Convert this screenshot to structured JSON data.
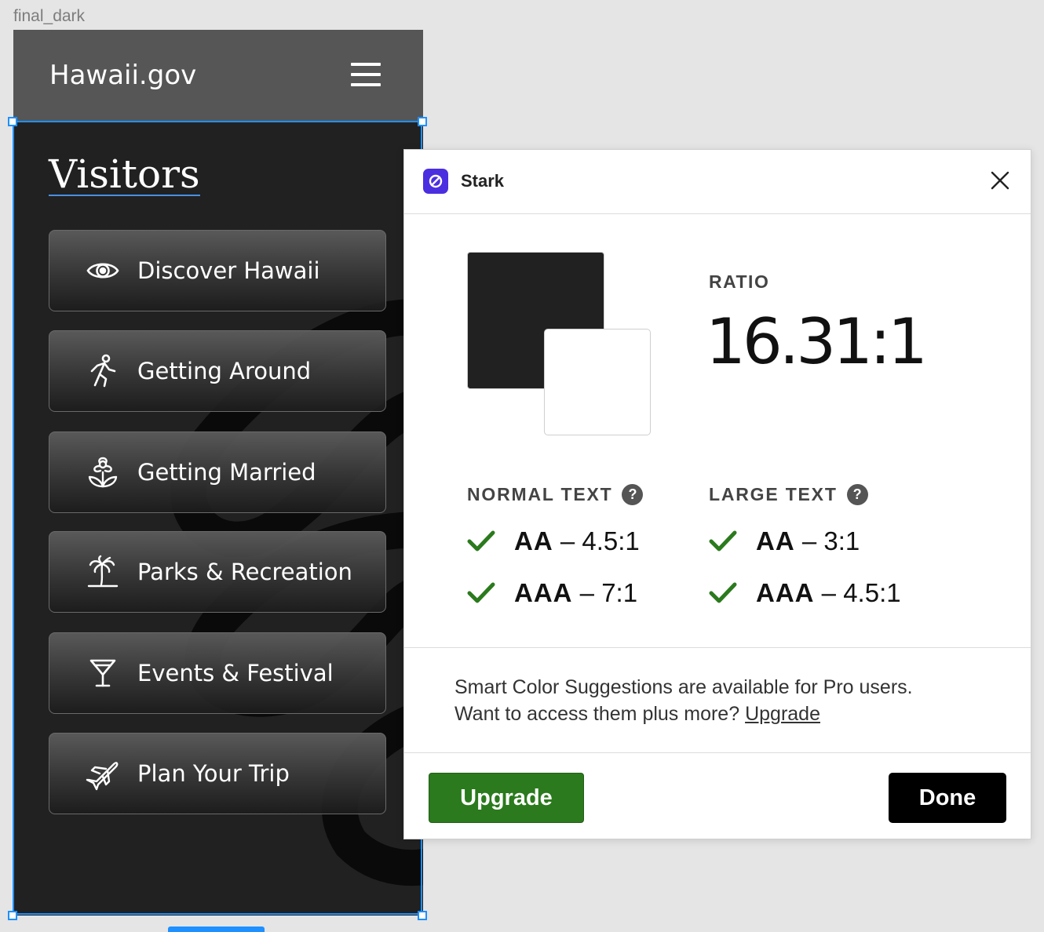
{
  "canvas": {
    "frame_label": "final_dark"
  },
  "site": {
    "title": "Hawaii.gov",
    "menu_icon": "hamburger-menu-icon",
    "page_heading": "Visitors",
    "nav_items": [
      {
        "label": "Discover Hawaii",
        "icon": "eye-icon"
      },
      {
        "label": "Getting Around",
        "icon": "walking-person-icon"
      },
      {
        "label": "Getting Married",
        "icon": "flower-icon"
      },
      {
        "label": "Parks & Recreation",
        "icon": "palm-tree-icon"
      },
      {
        "label": "Events & Festival",
        "icon": "cocktail-glass-icon"
      },
      {
        "label": "Plan Your Trip",
        "icon": "airplane-icon"
      }
    ]
  },
  "stark": {
    "title": "Stark",
    "logo_icon": "stark-logo-icon",
    "close_icon": "close-icon",
    "foreground_color": "#212121",
    "background_color": "#ffffff",
    "ratio_label": "RATIO",
    "ratio_value": "16.31:1",
    "normal_text": {
      "heading": "NORMAL TEXT",
      "help": "?",
      "checks": [
        {
          "level": "AA",
          "value": "– 4.5:1",
          "pass": true
        },
        {
          "level": "AAA",
          "value": "– 7:1",
          "pass": true
        }
      ]
    },
    "large_text": {
      "heading": "LARGE TEXT",
      "help": "?",
      "checks": [
        {
          "level": "AA",
          "value": "– 3:1",
          "pass": true
        },
        {
          "level": "AAA",
          "value": "– 4.5:1",
          "pass": true
        }
      ]
    },
    "promo_line1": "Smart Color Suggestions are available for Pro users.",
    "promo_line2": "Want to access them plus more?",
    "promo_link": "Upgrade",
    "upgrade_button": "Upgrade",
    "done_button": "Done"
  },
  "colors": {
    "pass_green": "#2b7a1d",
    "selection_blue": "#1e90ff",
    "stark_purple": "#4b2ee0"
  }
}
